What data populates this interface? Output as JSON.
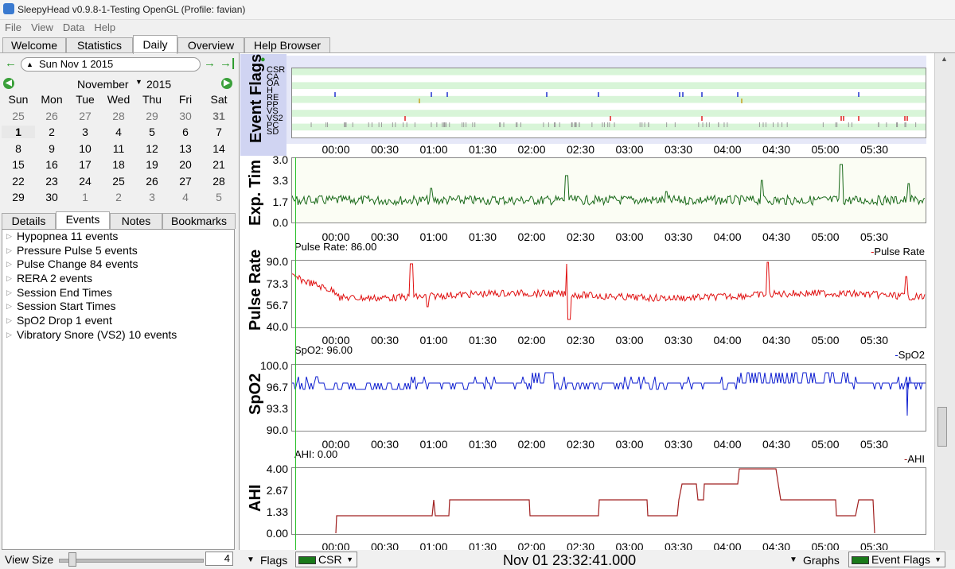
{
  "window": {
    "title": "SleepyHead v0.9.8-1-Testing OpenGL (Profile: favian)"
  },
  "menu": [
    "File",
    "View",
    "Data",
    "Help"
  ],
  "tabs": [
    {
      "label": "Welcome",
      "active": false
    },
    {
      "label": "Statistics",
      "active": false
    },
    {
      "label": "Daily",
      "active": true
    },
    {
      "label": "Overview",
      "active": false
    },
    {
      "label": "Help Browser",
      "active": false
    }
  ],
  "nav": {
    "back_icon": "arrow-left-icon",
    "date": "Sun Nov 1 2015",
    "forward_icon": "arrow-right-icon",
    "last_icon": "arrow-last-icon"
  },
  "calendar": {
    "month": "November",
    "year": "2015",
    "weekdays": [
      "Sun",
      "Mon",
      "Tue",
      "Wed",
      "Thu",
      "Fri",
      "Sat"
    ],
    "weeks": [
      [
        "25",
        "26",
        "27",
        "28",
        "29",
        "30",
        "31"
      ],
      [
        "1",
        "2",
        "3",
        "4",
        "5",
        "6",
        "7"
      ],
      [
        "8",
        "9",
        "10",
        "11",
        "12",
        "13",
        "14"
      ],
      [
        "15",
        "16",
        "17",
        "18",
        "19",
        "20",
        "21"
      ],
      [
        "22",
        "23",
        "24",
        "25",
        "26",
        "27",
        "28"
      ],
      [
        "29",
        "30",
        "1",
        "2",
        "3",
        "4",
        "5"
      ]
    ],
    "selected": "1"
  },
  "subtabs": [
    {
      "label": "Details",
      "active": false
    },
    {
      "label": "Events",
      "active": true
    },
    {
      "label": "Notes",
      "active": false
    },
    {
      "label": "Bookmarks",
      "active": false
    }
  ],
  "events": [
    "Hypopnea 11 events",
    "Pressure Pulse 5 events",
    "Pulse Change 84 events",
    "RERA 2 events",
    "Session End Times",
    "Session Start Times",
    "SpO2 Drop 1 event",
    "Vibratory Snore (VS2)  10 events"
  ],
  "view_size": {
    "label": "View Size",
    "value": "4"
  },
  "x_ticks": [
    "00:00",
    "00:30",
    "01:00",
    "01:30",
    "02:00",
    "02:30",
    "03:00",
    "03:30",
    "04:00",
    "04:30",
    "05:00",
    "05:30"
  ],
  "graphs": {
    "event_flags": {
      "ylabel": "Event Flags",
      "rows": [
        "CSR",
        "CA",
        "OA",
        "H",
        "RE",
        "PP",
        "VS",
        "VS2",
        "PC",
        "SD"
      ]
    },
    "exp_time": {
      "ylabel": "Exp. Tim",
      "ticks": [
        "3.0",
        "3.3",
        "1.7",
        "0.0"
      ]
    },
    "pulse": {
      "ylabel": "Pulse Rate",
      "readout": "Pulse Rate: 86.00",
      "legend": "Pulse Rate",
      "ticks": [
        "90.0",
        "73.3",
        "56.7",
        "40.0"
      ]
    },
    "spo2": {
      "ylabel": "SpO2",
      "readout": "SpO2: 96.00",
      "legend": "SpO2",
      "ticks": [
        "100.0",
        "96.7",
        "93.3",
        "90.0"
      ]
    },
    "ahi": {
      "ylabel": "AHI",
      "readout": "AHI: 0.00",
      "legend": "AHI",
      "ticks": [
        "4.00",
        "2.67",
        "1.33",
        "0.00"
      ]
    }
  },
  "bottom": {
    "flags_label": "Flags",
    "flags_combo": "CSR",
    "datetime": "Nov 01 23:32:41.000",
    "graphs_label": "Graphs",
    "graphs_combo": "Event Flags"
  },
  "colors": {
    "exp_time": "#1a6a1a",
    "pulse": "#e01010",
    "spo2": "#1020d0",
    "ahi": "#a02020",
    "flags_bg": "#d8f5d8"
  }
}
